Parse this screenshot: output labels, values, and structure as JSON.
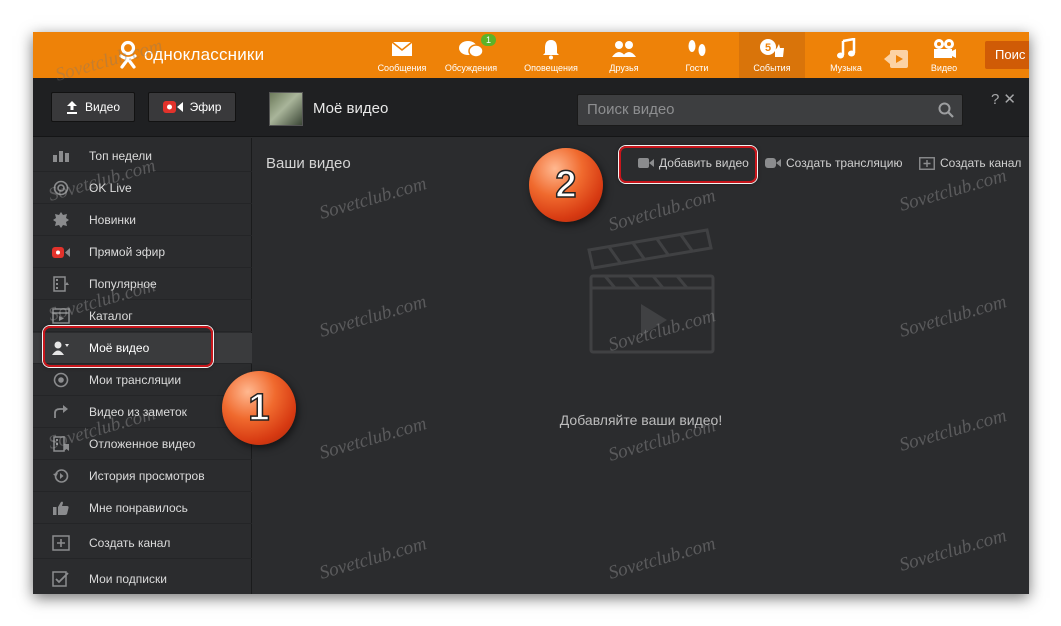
{
  "brand": {
    "name": "одноклассники"
  },
  "topnav": [
    {
      "label": "Сообщения",
      "icon": "envelope-icon"
    },
    {
      "label": "Обсуждения",
      "icon": "chat-bubbles-icon",
      "badge": "1"
    },
    {
      "label": "Оповещения",
      "icon": "bell-icon"
    },
    {
      "label": "Друзья",
      "icon": "friends-icon"
    },
    {
      "label": "Гости",
      "icon": "footprints-icon"
    },
    {
      "label": "События",
      "icon": "events-icon",
      "badge": "5",
      "active": true
    },
    {
      "label": "Музыка",
      "icon": "music-note-icon"
    },
    {
      "label": "",
      "icon": "video-play-icon"
    },
    {
      "label": "Видео",
      "icon": "film-camera-icon"
    }
  ],
  "search_button": "Поис",
  "header": {
    "video_button": "Видео",
    "live_button": "Эфир",
    "title": "Моё видео",
    "search_placeholder": "Поиск видео",
    "help": "?",
    "close": "✕"
  },
  "sidebar": {
    "items": [
      {
        "label": "Топ недели",
        "icon": "top-chart-icon"
      },
      {
        "label": "OK Live",
        "icon": "ok-live-icon"
      },
      {
        "label": "Новинки",
        "icon": "new-burst-icon"
      },
      {
        "label": "Прямой эфир",
        "icon": "live-camera-icon"
      },
      {
        "label": "Популярное",
        "icon": "popular-film-icon"
      },
      {
        "label": "Каталог",
        "icon": "catalog-icon"
      },
      {
        "label": "Моё видео",
        "icon": "my-video-user-icon",
        "selected": true
      },
      {
        "label": "Мои трансляции",
        "icon": "broadcast-icon"
      },
      {
        "label": "Видео из заметок",
        "icon": "share-arrow-icon"
      },
      {
        "label": "Отложенное видео",
        "icon": "bookmark-film-icon"
      },
      {
        "label": "История просмотров",
        "icon": "history-icon"
      },
      {
        "label": "Мне понравилось",
        "icon": "thumbs-up-icon"
      },
      {
        "label": "Создать канал",
        "icon": "add-channel-icon"
      },
      {
        "label": "Мои подписки",
        "icon": "subscriptions-icon"
      }
    ]
  },
  "main": {
    "section_title": "Ваши видео",
    "actions": {
      "add_video": "Добавить видео",
      "create_broadcast": "Создать трансляцию",
      "create_channel": "Создать канал"
    },
    "empty_text": "Добавляйте ваши видео!"
  },
  "annotations": {
    "step1": "1",
    "step2": "2"
  },
  "watermark": "Sovetclub.com",
  "colors": {
    "brand_orange": "#ee8208",
    "panel_dark": "#2b2c2e",
    "header_dark": "#1f2022",
    "annotation_red": "#c8151b"
  }
}
